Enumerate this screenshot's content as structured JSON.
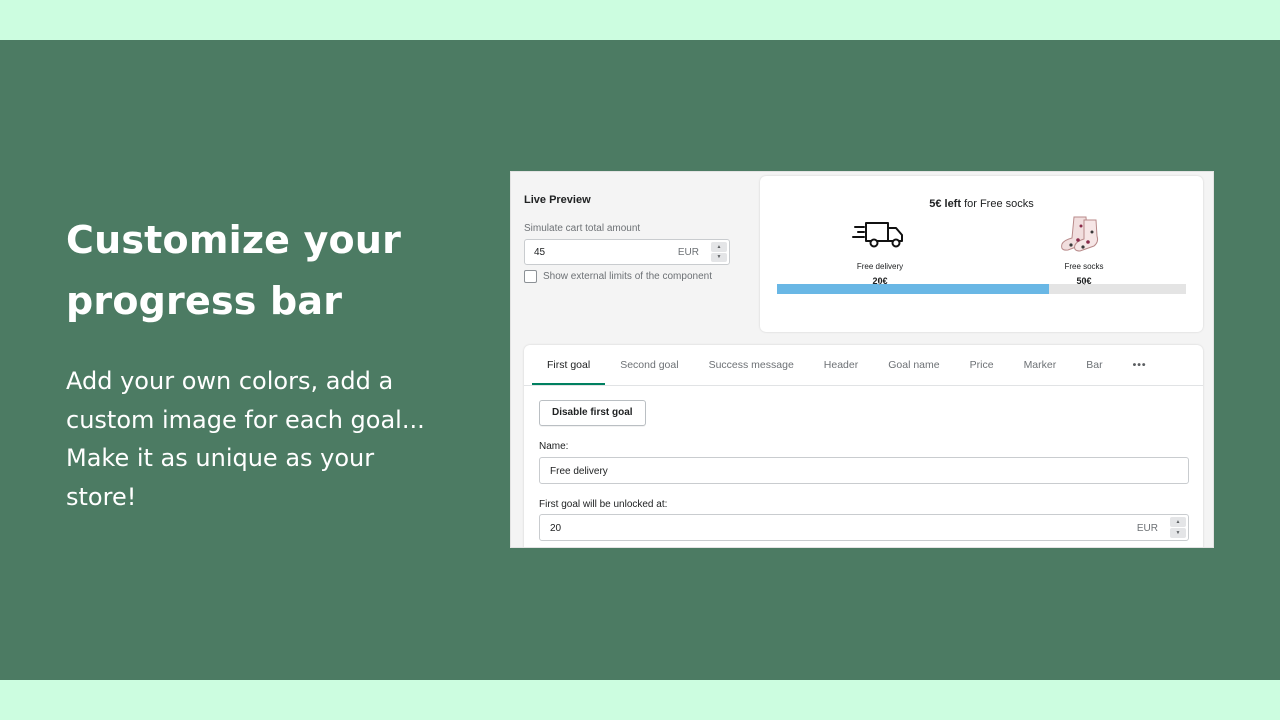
{
  "headline": "Customize your progress bar",
  "subtext": "Add your own colors, add a custom image for each goal... Make it as unique as your store!",
  "colors": {
    "background_band": "#ccfde0",
    "slide": "#4c7b63",
    "bar_fill": "#69b7e5",
    "bar_track": "#e4e4e4",
    "active_tab": "#008060"
  },
  "app": {
    "live_preview": {
      "title": "Live Preview",
      "simulate_label": "Simulate cart total amount",
      "simulate_value": "45",
      "simulate_currency": "EUR",
      "stepper_up": "▲",
      "stepper_down": "▼",
      "show_limits_label": "Show external limits of the component",
      "show_limits_checked": false
    },
    "preview": {
      "message_bold": "5€ left",
      "message_rest": " for Free socks",
      "progress_fraction": 0.665,
      "goals": [
        {
          "name": "Free delivery",
          "price": "20€",
          "icon": "delivery-truck-icon",
          "marker_fraction": 0.25
        },
        {
          "name": "Free socks",
          "price": "50€",
          "icon": "socks-icon",
          "marker_fraction": 0.75
        }
      ]
    },
    "tabs": [
      {
        "label": "First goal",
        "active": true
      },
      {
        "label": "Second goal"
      },
      {
        "label": "Success message"
      },
      {
        "label": "Header"
      },
      {
        "label": "Goal name"
      },
      {
        "label": "Price"
      },
      {
        "label": "Marker"
      },
      {
        "label": "Bar"
      },
      {
        "label": "•••"
      }
    ],
    "form": {
      "disable_button": "Disable first goal",
      "name_label": "Name:",
      "name_value": "Free delivery",
      "unlock_label": "First goal will be unlocked at:",
      "unlock_value": "20",
      "unlock_currency": "EUR"
    }
  }
}
